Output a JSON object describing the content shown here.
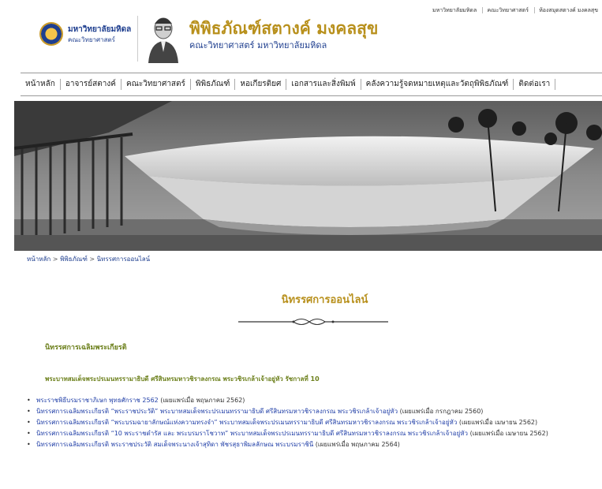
{
  "top_links": [
    "มหาวิทยาลัยมหิดล",
    "คณะวิทยาศาสตร์",
    "ห้องสมุดสตางค์ มงคลสุข"
  ],
  "header": {
    "university_name": "มหาวิทยาลัยมหิดล",
    "university_sub": "คณะวิทยาศาสตร์",
    "site_title": "พิพิธภัณฑ์สตางค์ มงคลสุข",
    "site_subtitle": "คณะวิทยาศาสตร์ มหาวิทยาลัยมหิดล"
  },
  "nav": [
    {
      "label": "หน้าหลัก"
    },
    {
      "label": "อาจารย์สตางค์"
    },
    {
      "label": "คณะวิทยาศาสตร์"
    },
    {
      "label": "พิพิธภัณฑ์"
    },
    {
      "label": "หอเกียรติยศ"
    },
    {
      "label": "เอกสารและสิ่งพิมพ์"
    },
    {
      "label": "คลังความรู้จดหมายเหตุและวัตถุพิพิธภัณฑ์"
    },
    {
      "label": "ติดต่อเรา"
    }
  ],
  "breadcrumb": {
    "home": "หน้าหลัก",
    "sep1": " > ",
    "museum": "พิพิธภัณฑ์",
    "sep2": " > ",
    "current": "นิทรรศการออนไลน์"
  },
  "page_title": "นิทรรศการออนไลน์",
  "section": {
    "heading": "นิทรรศการเฉลิมพระเกียรติ",
    "subheading": "พระบาทสมเด็จพระปรเมนทรรามาธิบดี ศรีสินทรมหาวชิราลงกรณ พระวชิรเกล้าเจ้าอยู่หัว รัชกาลที่ 10"
  },
  "exhibitions": [
    {
      "link": "พระราชพิธีบรมราชาภิเษก พุทธศักราช 2562",
      "note": " (เผยแพร่เมื่อ พฤษภาคม 2562)"
    },
    {
      "link": "นิทรรศการเฉลิมพระเกียรติ “พระราชประวัติ” พระบาทสมเด็จพระปรเมนทรรามาธิบดี ศรีสินทรมหาวชิราลงกรณ พระวชิรเกล้าเจ้าอยู่หัว",
      "note": " (เผยแพร่เมื่อ กรกฎาคม 2560)"
    },
    {
      "link": "นิทรรศการเฉลิมพระเกียรติ “พระบรมฉายาลักษณ์แห่งความทรงจำ” พระบาทสมเด็จพระปรเมนทรรามาธิบดี ศรีสินทรมหาวชิราลงกรณ พระวชิรเกล้าเจ้าอยู่หัว",
      "note": " (เผยแพร่เมื่อ เมษายน 2562)"
    },
    {
      "link": "นิทรรศการเฉลิมพระเกียรติ “10 พระราชดำรัส และ พระบรมราโชวาท” พระบาทสมเด็จพระปรเมนทรรามาธิบดี ศรีสินทรมหาวชิราลงกรณ พระวชิรเกล้าเจ้าอยู่หัว",
      "note": " (เผยแพร่เมื่อ เมษายน 2562)"
    },
    {
      "link": "นิทรรศการเฉลิมพระเกียรติ พระราชประวัติ สมเด็จพระนางเจ้าสุทิดา พัชรสุธาพิมลลักษณ พระบรมราชินี",
      "note": " (เผยแพร่เมื่อ พฤษภาคม 2564)"
    }
  ],
  "colors": {
    "gold": "#b8901c",
    "navy": "#1f3f8f",
    "olive": "#6b7f1a",
    "link": "#2240a8"
  }
}
